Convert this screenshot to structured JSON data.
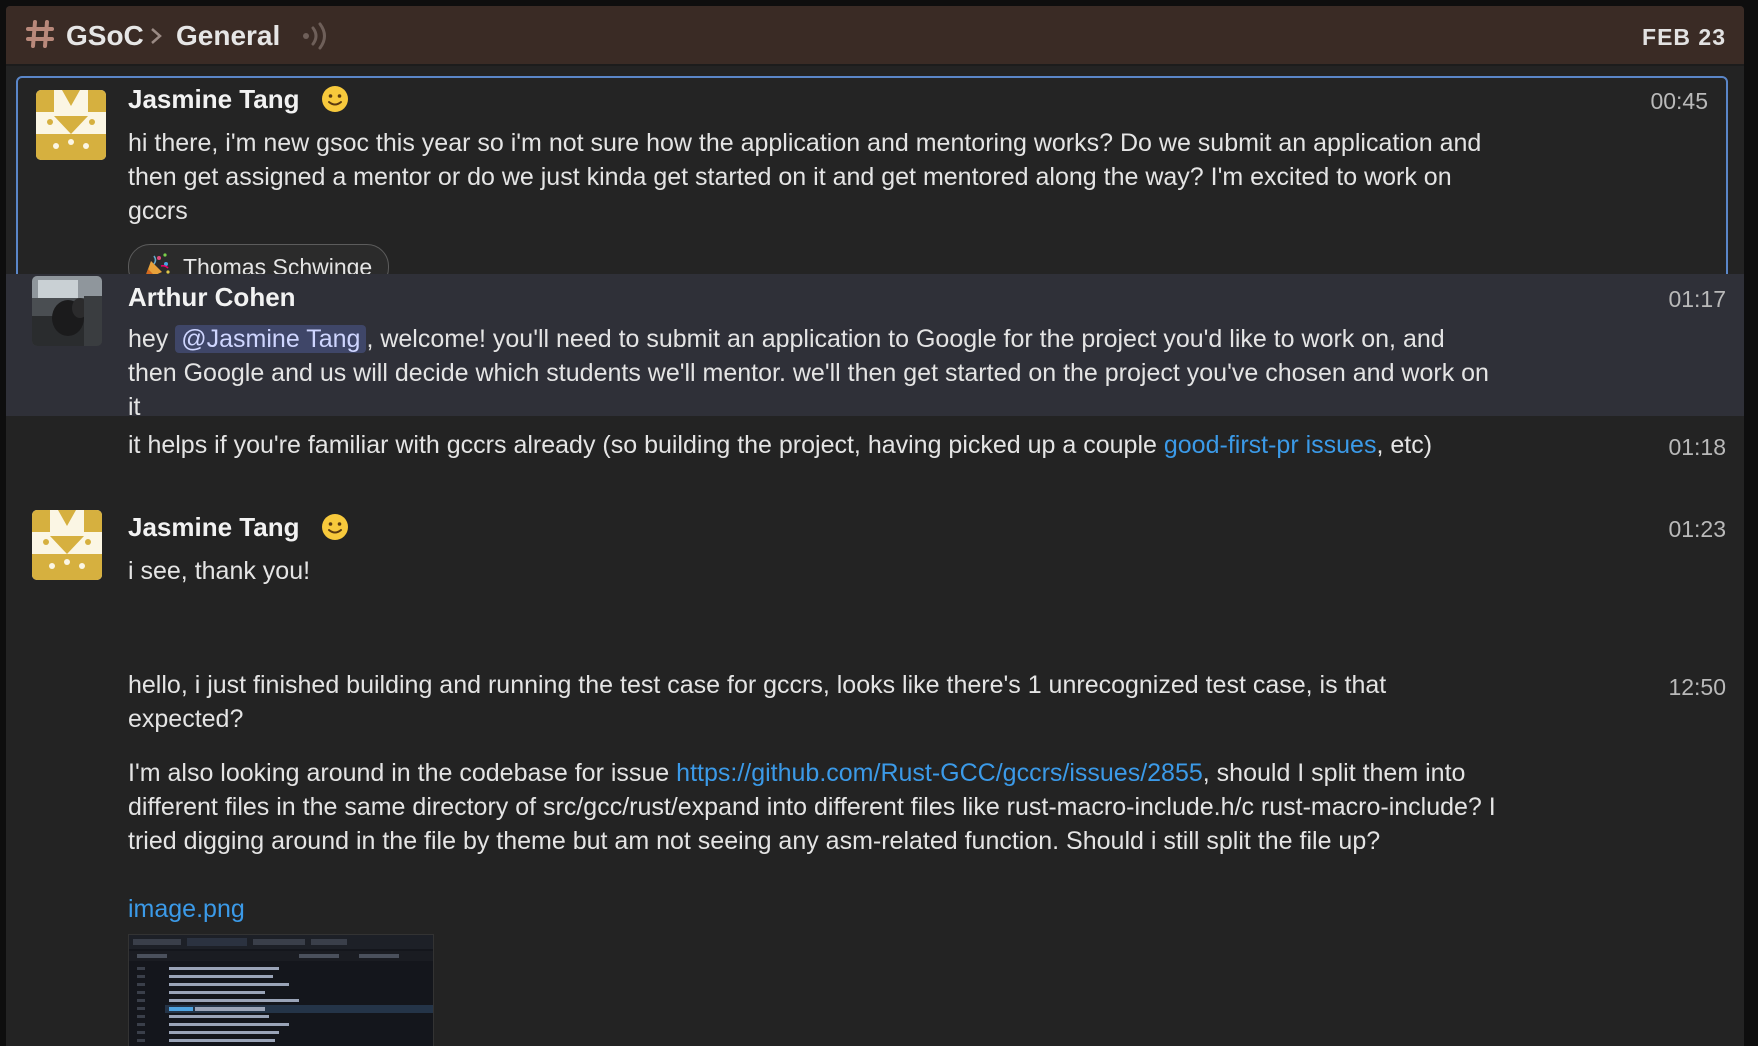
{
  "header": {
    "space": "GSoC",
    "room": "General",
    "date": "FEB 23"
  },
  "messages": [
    {
      "author": "Jasmine Tang",
      "time": "00:45",
      "body": "hi there, i'm new gsoc this year so i'm not sure how the application and mentoring works? Do we submit an application and then get assigned a mentor or do we just kinda get started on it and get mentored along the way? I'm excited to work on gccrs",
      "reaction": {
        "icon": "party-popper",
        "user": "Thomas Schwinge"
      }
    },
    {
      "author": "Arthur Cohen",
      "time": "01:17",
      "body_prefix": "hey ",
      "mention": "@Jasmine Tang",
      "body_suffix": ", welcome! you'll need to submit an application to Google for the project you'd like to work on, and then Google and us will decide which students we'll mentor. we'll then get started on the project you've chosen and work on it"
    },
    {
      "time": "01:18",
      "body_prefix": "it helps if you're familiar with gccrs already (so building the project, having picked up a couple ",
      "link": "good-first-pr issues",
      "body_suffix": ", etc)"
    },
    {
      "author": "Jasmine Tang",
      "time": "01:23",
      "body": "i see, thank you!"
    },
    {
      "time": "12:50",
      "body": "hello, i just finished building and running the test case for gccrs, looks like there's 1 unrecognized test case, is that expected?"
    },
    {
      "body_prefix": "I'm also looking around in the codebase for issue ",
      "link": "https://github.com/Rust-GCC/gccrs/issues/2855",
      "body_suffix": ", should I split them into different files in the same directory of src/gcc/rust/expand into different files like rust-macro-include.h/c rust-macro-include? I tried digging around in the file by theme but am not seeing any asm-related function. Should i still split the file up?",
      "attachment": "image.png"
    }
  ],
  "icons": {
    "room": "hash-icon",
    "separator": "chevron-right-icon",
    "call": "speaker-icon",
    "status": "slightly-smiling-face-emoji",
    "reaction": "party-popper-emoji"
  },
  "colors": {
    "topbar": "#3a2b25",
    "background": "#232323",
    "hover_row": "#2f3038",
    "selected_border": "#5a86c8",
    "link": "#3b9ae8",
    "mention_bg": "#3f4668"
  }
}
